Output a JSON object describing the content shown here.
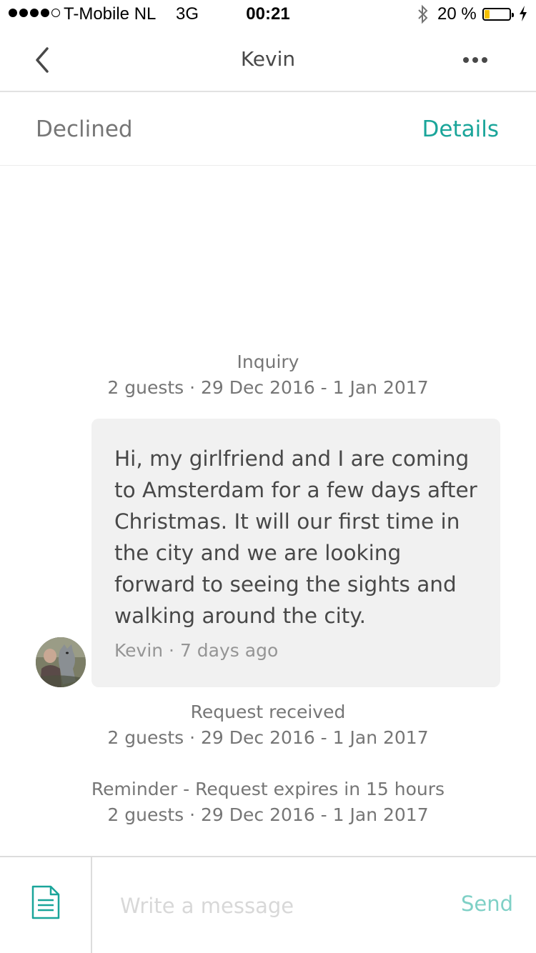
{
  "status_bar": {
    "carrier": "T-Mobile NL",
    "network": "3G",
    "time": "00:21",
    "battery_percent": "20 %",
    "battery_level": 0.2,
    "icons": [
      "signal-dots",
      "bluetooth-icon",
      "battery-icon",
      "charging-bolt-icon"
    ]
  },
  "nav": {
    "title": "Kevin",
    "back_icon": "chevron-left-icon",
    "more_icon": "more-dots-icon"
  },
  "reservation": {
    "status": "Declined",
    "details_label": "Details",
    "accent_color": "#1aa59a"
  },
  "events": {
    "inquiry": {
      "title": "Inquiry",
      "subtitle": "2 guests · 29 Dec 2016 - 1 Jan 2017"
    },
    "request": {
      "title": "Request received",
      "subtitle": "2 guests · 29 Dec 2016 - 1 Jan 2017"
    },
    "reminder": {
      "title": "Reminder - Request expires in 15 hours",
      "subtitle": "2 guests · 29 Dec 2016 - 1 Jan 2017"
    }
  },
  "message": {
    "lines": [
      "Hi, my girlfriend and I are coming",
      "to Amsterdam for a few days after",
      "Christmas. It will our first time in",
      "the city and we are looking",
      "forward to seeing the sights and",
      "walking around the city."
    ],
    "meta": "Kevin · 7 days ago"
  },
  "composer": {
    "placeholder": "Write a message",
    "send_label": "Send",
    "template_icon": "document-icon"
  }
}
